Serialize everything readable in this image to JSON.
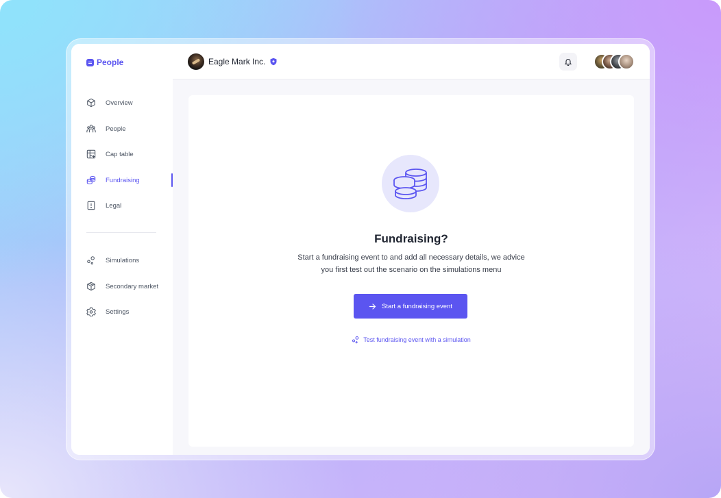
{
  "app": {
    "logo_label": "People"
  },
  "sidebar": {
    "items": [
      {
        "label": "Overview",
        "icon": "cube-icon"
      },
      {
        "label": "People",
        "icon": "people-icon"
      },
      {
        "label": "Cap table",
        "icon": "table-icon"
      },
      {
        "label": "Fundraising",
        "icon": "coins-icon",
        "active": true
      },
      {
        "label": "Legal",
        "icon": "legal-doc-icon"
      }
    ],
    "secondary_items": [
      {
        "label": "Simulations",
        "icon": "simulation-icon"
      },
      {
        "label": "Secondary market",
        "icon": "package-icon"
      },
      {
        "label": "Settings",
        "icon": "settings-icon"
      }
    ]
  },
  "header": {
    "company_name": "Eagle Mark Inc.",
    "notifications_icon": "bell-icon"
  },
  "empty_state": {
    "icon": "coins-stack-icon",
    "title": "Fundraising?",
    "description": "Start a fundraising event to and add all necessary details, we advice you first test out the scenario on the simulations menu",
    "primary_button_label": "Start a fundraising event",
    "secondary_link_label": "Test fundraising event with a simulation"
  },
  "colors": {
    "accent": "#5b55f0",
    "accent_soft": "#e7e7fc",
    "text": "#1f2430",
    "muted_text": "#4c5563"
  }
}
